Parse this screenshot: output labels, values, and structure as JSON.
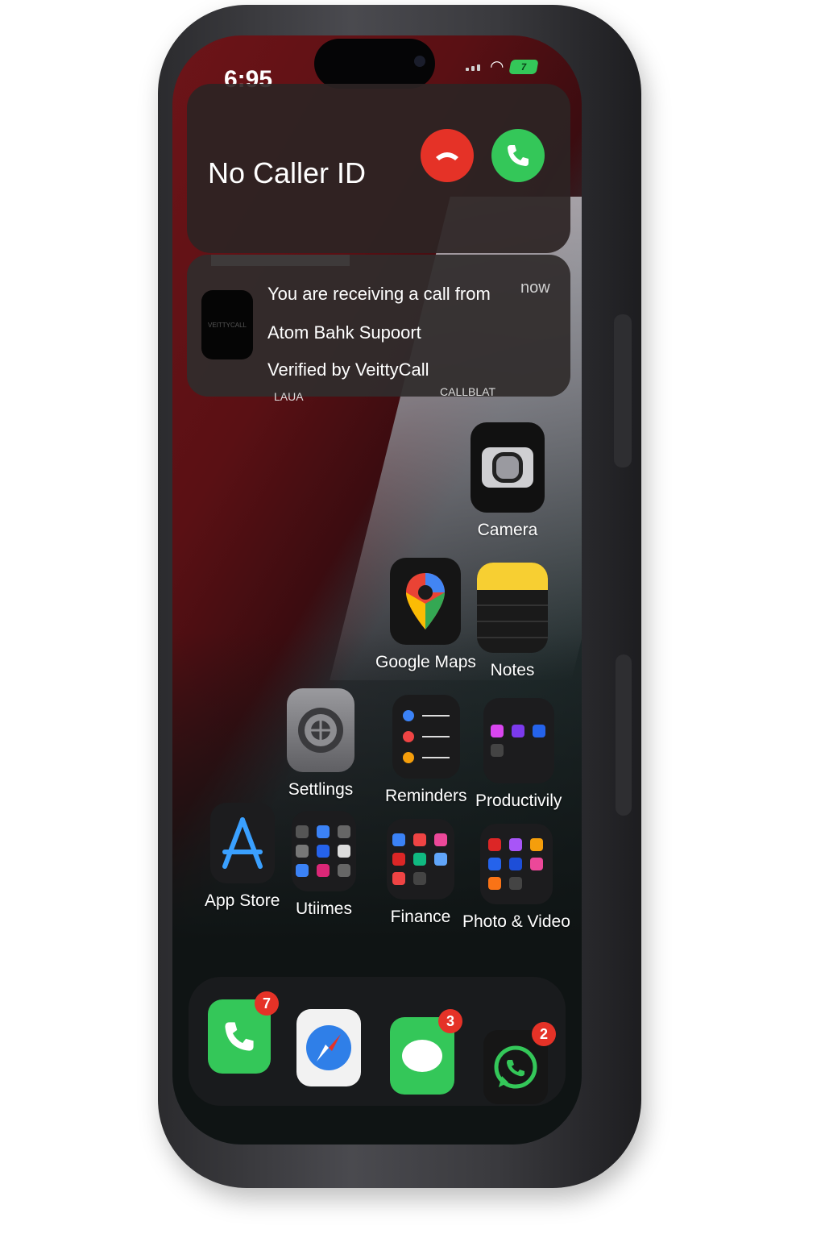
{
  "status_bar": {
    "time": "6:95",
    "battery": "7"
  },
  "incoming_call": {
    "caller": "No Caller ID"
  },
  "notification": {
    "line1": "You are receiving a call from",
    "line2": "Atom Bahk Supoort",
    "line3": "Verified by VeittyCall",
    "time": "now",
    "icon_text": "VEITTYCALL"
  },
  "peek_labels": {
    "left": "LAUA",
    "right": "CALLBLAT"
  },
  "apps": {
    "camera": "Camera",
    "google_maps": "Google Maps",
    "notes": "Notes",
    "settings": "Settlings",
    "reminders": "Reminders",
    "productivity": "Productivily",
    "app_store": "App Store",
    "utilities": "Utiimes",
    "finance": "Finance",
    "photo_video": "Photo & Video"
  },
  "dock": {
    "phone_badge": "7",
    "messages_badge": "3",
    "whatsapp_badge": "2"
  },
  "colors": {
    "decline": "#e53227",
    "accept": "#34c759",
    "badge": "#e53227"
  }
}
